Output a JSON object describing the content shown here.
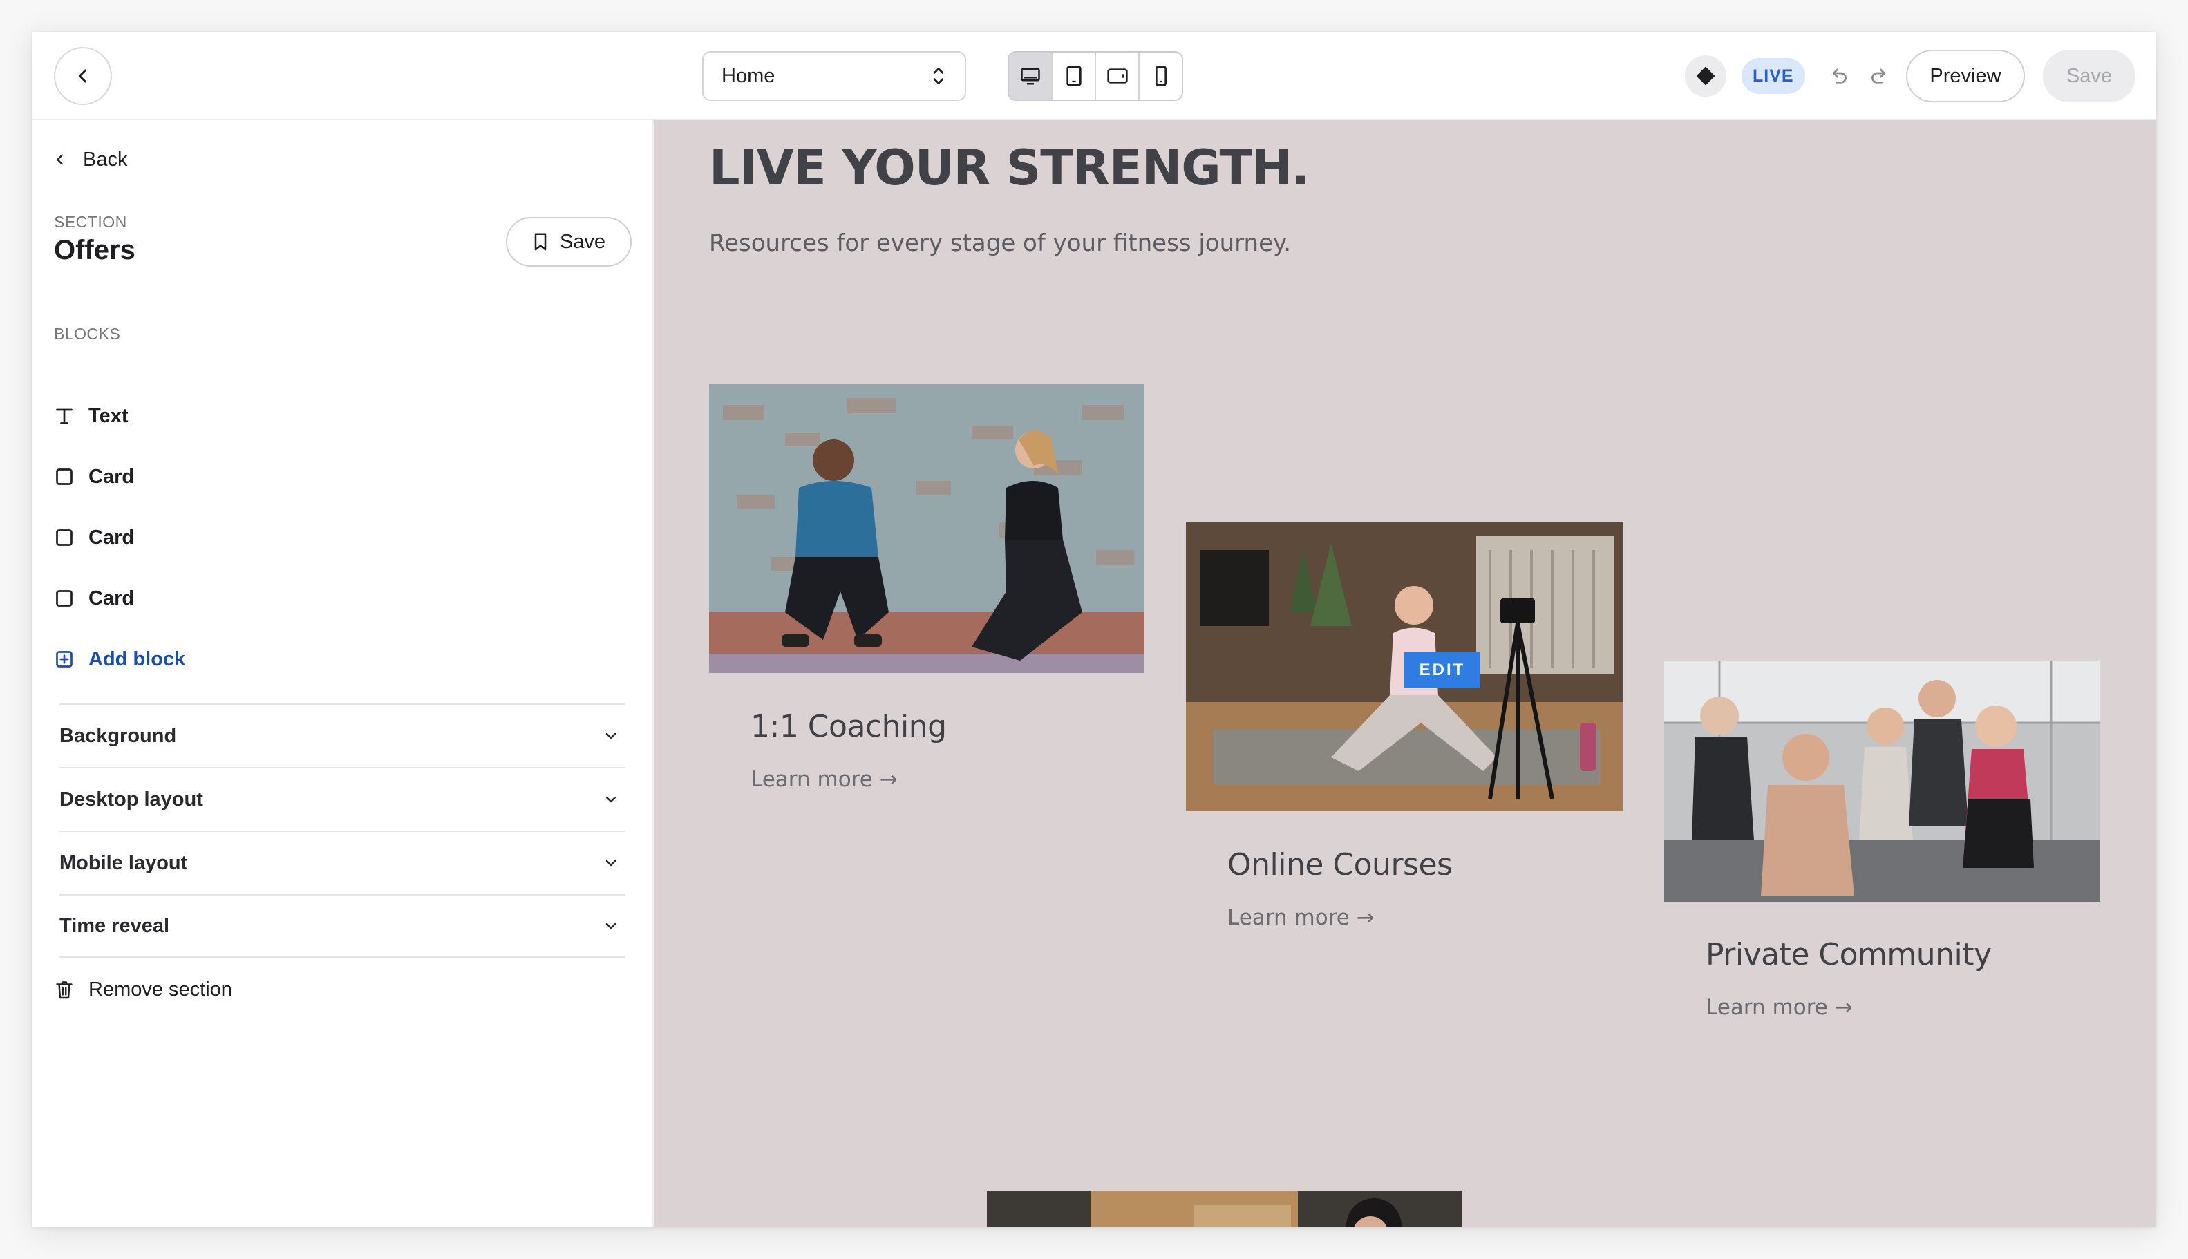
{
  "topbar": {
    "page_select_value": "Home",
    "live_label": "LIVE",
    "preview_label": "Preview",
    "save_label": "Save"
  },
  "sidebar": {
    "back_label": "Back",
    "section_kicker": "SECTION",
    "section_title": "Offers",
    "save_label": "Save",
    "blocks_kicker": "BLOCKS",
    "blocks": [
      {
        "label": "Text",
        "icon": "text-type-icon"
      },
      {
        "label": "Card",
        "icon": "square-icon"
      },
      {
        "label": "Card",
        "icon": "square-icon"
      },
      {
        "label": "Card",
        "icon": "square-icon"
      }
    ],
    "add_block_label": "Add block",
    "accordions": [
      "Background",
      "Desktop layout",
      "Mobile layout",
      "Time reveal"
    ],
    "remove_label": "Remove section"
  },
  "canvas": {
    "title": "LIVE YOUR STRENGTH.",
    "subtitle": "Resources for every stage of your fitness journey.",
    "edit_label": "EDIT",
    "cards": [
      {
        "title": "1:1 Coaching",
        "link": "Learn more →"
      },
      {
        "title": "Online Courses",
        "link": "Learn more →"
      },
      {
        "title": "Private Community",
        "link": "Learn more →"
      }
    ]
  },
  "colors": {
    "canvas_bg": "#dbd3d3",
    "accent_blue": "#2f7de2",
    "live_badge_bg": "#dbe8fb"
  }
}
